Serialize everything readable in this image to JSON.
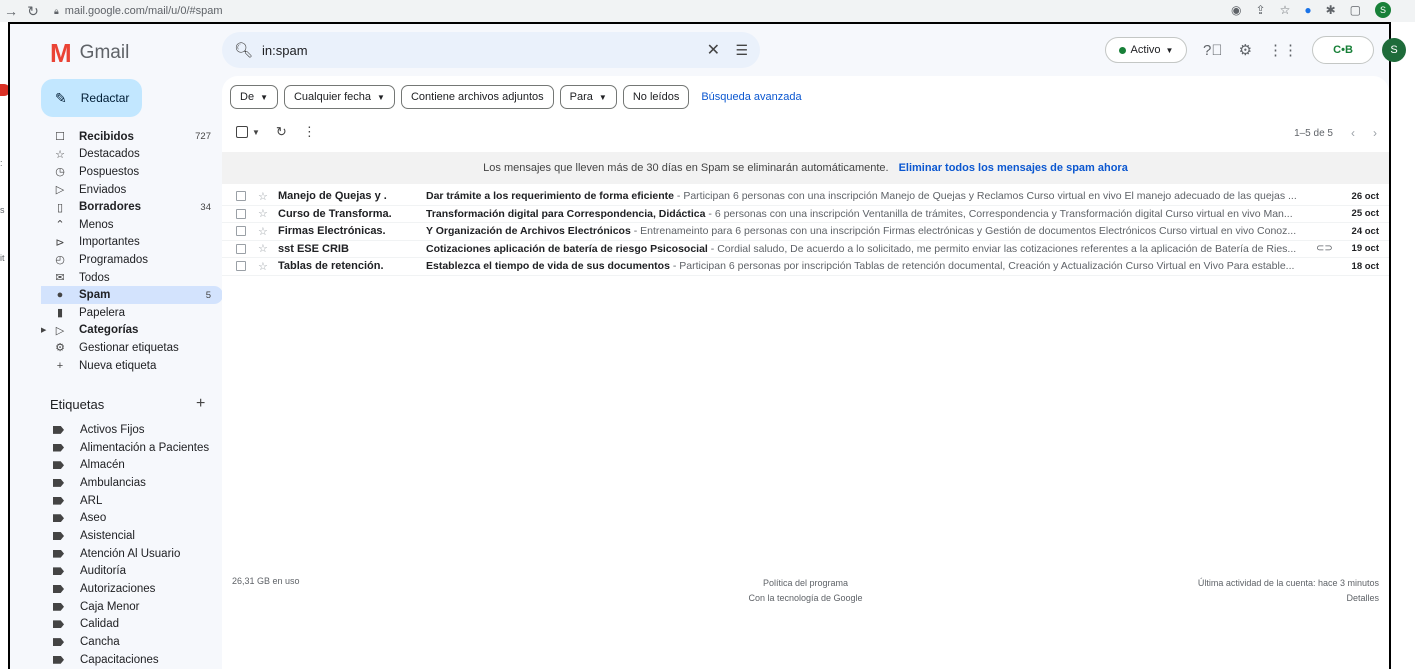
{
  "browser": {
    "url": "mail.google.com/mail/u/0/#spam",
    "avatar": "S"
  },
  "outer_labels": [
    "s",
    "it",
    ":"
  ],
  "header": {
    "app_name": "Gmail",
    "search_value": "in:spam",
    "status_label": "Activo",
    "org_logo_text": "C•B",
    "avatar": "S"
  },
  "sidebar": {
    "compose_label": "Redactar",
    "items": [
      {
        "label": "Recibidos",
        "count": "727",
        "icon": "inbox-icon",
        "glyph": "☐",
        "bold": true
      },
      {
        "label": "Destacados",
        "count": "",
        "icon": "star-icon",
        "glyph": "☆"
      },
      {
        "label": "Pospuestos",
        "count": "",
        "icon": "clock-icon",
        "glyph": "◷"
      },
      {
        "label": "Enviados",
        "count": "",
        "icon": "send-icon",
        "glyph": "▷"
      },
      {
        "label": "Borradores",
        "count": "34",
        "icon": "draft-icon",
        "glyph": "▯",
        "bold": true
      },
      {
        "label": "Menos",
        "count": "",
        "icon": "chevron-up-icon",
        "glyph": "⌃"
      },
      {
        "label": "Importantes",
        "count": "",
        "icon": "important-icon",
        "glyph": "⊳"
      },
      {
        "label": "Programados",
        "count": "",
        "icon": "scheduled-icon",
        "glyph": "◴"
      },
      {
        "label": "Todos",
        "count": "",
        "icon": "all-mail-icon",
        "glyph": "✉"
      },
      {
        "label": "Spam",
        "count": "5",
        "icon": "spam-icon",
        "glyph": "●",
        "active": true
      },
      {
        "label": "Papelera",
        "count": "",
        "icon": "trash-icon",
        "glyph": "▮"
      },
      {
        "label": "Categorías",
        "count": "",
        "icon": "label-icon",
        "glyph": "▷",
        "bold": true,
        "caret": true
      },
      {
        "label": "Gestionar etiquetas",
        "count": "",
        "icon": "gear-icon",
        "glyph": "⚙"
      },
      {
        "label": "Nueva etiqueta",
        "count": "",
        "icon": "plus-icon",
        "glyph": "+"
      }
    ],
    "labels_title": "Etiquetas",
    "labels": [
      "Activos Fijos",
      "Alimentación a Pacientes",
      "Almacén",
      "Ambulancias",
      "ARL",
      "Aseo",
      "Asistencial",
      "Atención Al Usuario",
      "Auditoría",
      "Autorizaciones",
      "Caja Menor",
      "Calidad",
      "Cancha",
      "Capacitaciones"
    ]
  },
  "filters": {
    "chips": [
      {
        "label": "De",
        "dropdown": true
      },
      {
        "label": "Cualquier fecha",
        "dropdown": true
      },
      {
        "label": "Contiene archivos adjuntos",
        "dropdown": false
      },
      {
        "label": "Para",
        "dropdown": true
      },
      {
        "label": "No leídos",
        "dropdown": false
      }
    ],
    "advanced_search": "Búsqueda avanzada"
  },
  "toolbar": {
    "pagination": "1–5 de 5"
  },
  "banner": {
    "text": "Los mensajes que lleven más de 30 días en Spam se eliminarán automáticamente.",
    "link": "Eliminar todos los mensajes de spam ahora"
  },
  "emails": [
    {
      "sender": "Manejo de Quejas y .",
      "subject": "Dar trámite a los requerimiento de forma eficiente",
      "snippet": " - Participan 6 personas con una inscripción Manejo de Quejas y Reclamos Curso virtual en vivo El manejo adecuado de las quejas ...",
      "date": "26 oct",
      "attachment": false
    },
    {
      "sender": "Curso de Transforma.",
      "subject": "Transformación digital para Correspondencia, Didáctica",
      "snippet": " - 6 personas con una inscripción Ventanilla de trámites, Correspondencia y Transformación digital Curso virtual en vivo Man...",
      "date": "25 oct",
      "attachment": false
    },
    {
      "sender": "Firmas Electrónicas.",
      "subject": "Y Organización de Archivos Electrónicos",
      "snippet": " - Entrenameinto para 6 personas con una inscripción Firmas electrónicas y Gestión de documentos Electrónicos Curso virtual en vivo Conoz...",
      "date": "24 oct",
      "attachment": false
    },
    {
      "sender": "sst ESE CRIB",
      "subject": "Cotizaciones aplicación de batería de riesgo Psicosocial",
      "snippet": " - Cordial saludo, De acuerdo a lo solicitado, me permito enviar las cotizaciones referentes a la aplicación de Batería de Ries...",
      "date": "19 oct",
      "attachment": true
    },
    {
      "sender": "Tablas de retención.",
      "subject": "Establezca el tiempo de vida de sus documentos",
      "snippet": " - Participan 6 personas por inscripción Tablas de retención documental, Creación y Actualización Curso Virtual en Vivo Para estable...",
      "date": "18 oct",
      "attachment": false
    }
  ],
  "footer": {
    "storage": "26,31 GB en uso",
    "policy": "Política del programa",
    "powered": "Con la tecnología de Google",
    "last_activity": "Última actividad de la cuenta: hace 3 minutos",
    "details": "Detalles"
  }
}
